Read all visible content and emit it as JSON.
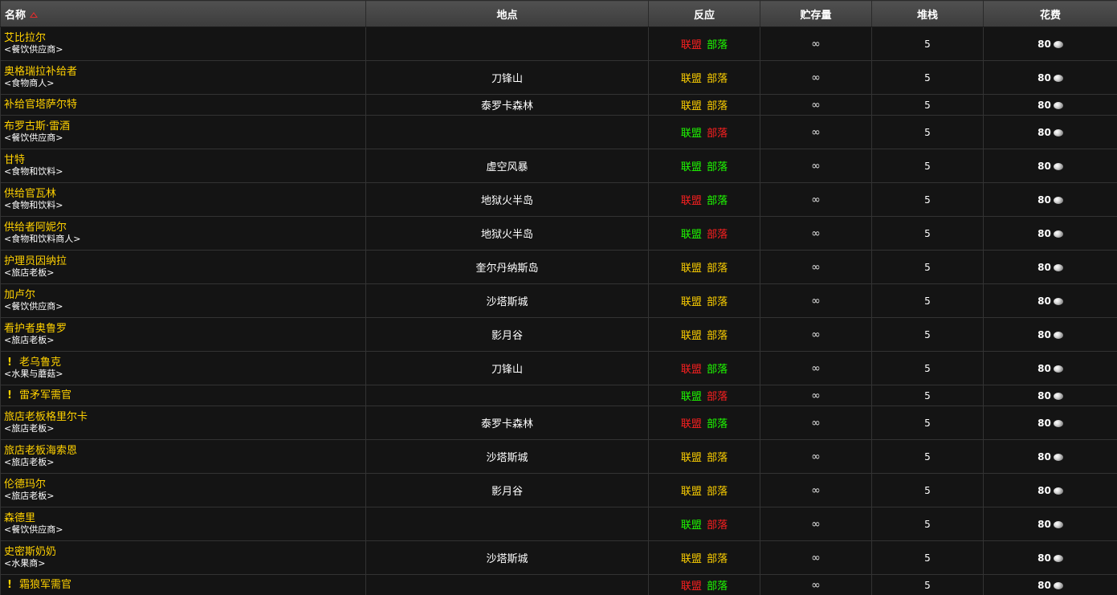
{
  "header": {
    "name": "名称",
    "location": "地点",
    "react": "反应",
    "stock": "贮存量",
    "stack": "堆栈",
    "cost": "花费"
  },
  "labels": {
    "alliance": "联盟",
    "horde": "部落",
    "infinite": "∞",
    "quest_mark": "!"
  },
  "colors": {
    "name": "#ffd100",
    "friendly": "#1eff00",
    "neutral": "#ffd100",
    "hostile": "#ff2020"
  },
  "rows": [
    {
      "name": "艾比拉尔",
      "tag": "<餐饮供应商>",
      "location": "",
      "alliance": "red",
      "horde": "green",
      "stack": "5",
      "cost": "80",
      "quest": false
    },
    {
      "name": "奥格瑞拉补给者",
      "tag": "<食物商人>",
      "location": "刀锋山",
      "alliance": "yellow",
      "horde": "yellow",
      "stack": "5",
      "cost": "80",
      "quest": false
    },
    {
      "name": "补给官塔萨尔特",
      "tag": "",
      "location": "泰罗卡森林",
      "alliance": "yellow",
      "horde": "yellow",
      "stack": "5",
      "cost": "80",
      "quest": false
    },
    {
      "name": "布罗古斯·雷酒",
      "tag": "<餐饮供应商>",
      "location": "",
      "alliance": "green",
      "horde": "red",
      "stack": "5",
      "cost": "80",
      "quest": false
    },
    {
      "name": "甘特",
      "tag": "<食物和饮料>",
      "location": "虚空风暴",
      "alliance": "green",
      "horde": "green",
      "stack": "5",
      "cost": "80",
      "quest": false
    },
    {
      "name": "供给官瓦林",
      "tag": "<食物和饮料>",
      "location": "地狱火半岛",
      "alliance": "red",
      "horde": "green",
      "stack": "5",
      "cost": "80",
      "quest": false
    },
    {
      "name": "供给者阿妮尔",
      "tag": "<食物和饮料商人>",
      "location": "地狱火半岛",
      "alliance": "green",
      "horde": "red",
      "stack": "5",
      "cost": "80",
      "quest": false
    },
    {
      "name": "护理员因纳拉",
      "tag": "<旅店老板>",
      "location": "奎尔丹纳斯岛",
      "alliance": "yellow",
      "horde": "yellow",
      "stack": "5",
      "cost": "80",
      "quest": false
    },
    {
      "name": "加卢尔",
      "tag": "<餐饮供应商>",
      "location": "沙塔斯城",
      "alliance": "yellow",
      "horde": "yellow",
      "stack": "5",
      "cost": "80",
      "quest": false
    },
    {
      "name": "看护者奥鲁罗",
      "tag": "<旅店老板>",
      "location": "影月谷",
      "alliance": "yellow",
      "horde": "yellow",
      "stack": "5",
      "cost": "80",
      "quest": false
    },
    {
      "name": "老乌鲁克",
      "tag": "<水果与蘑菇>",
      "location": "刀锋山",
      "alliance": "red",
      "horde": "green",
      "stack": "5",
      "cost": "80",
      "quest": true
    },
    {
      "name": "雷矛军需官",
      "tag": "",
      "location": "",
      "alliance": "green",
      "horde": "red",
      "stack": "5",
      "cost": "80",
      "quest": true
    },
    {
      "name": "旅店老板格里尔卡",
      "tag": "<旅店老板>",
      "location": "泰罗卡森林",
      "alliance": "red",
      "horde": "green",
      "stack": "5",
      "cost": "80",
      "quest": false
    },
    {
      "name": "旅店老板海索恩",
      "tag": "<旅店老板>",
      "location": "沙塔斯城",
      "alliance": "yellow",
      "horde": "yellow",
      "stack": "5",
      "cost": "80",
      "quest": false
    },
    {
      "name": "伦德玛尔",
      "tag": "<旅店老板>",
      "location": "影月谷",
      "alliance": "yellow",
      "horde": "yellow",
      "stack": "5",
      "cost": "80",
      "quest": false
    },
    {
      "name": "森德里",
      "tag": "<餐饮供应商>",
      "location": "",
      "alliance": "green",
      "horde": "red",
      "stack": "5",
      "cost": "80",
      "quest": false
    },
    {
      "name": "史密斯奶奶",
      "tag": "<水果商>",
      "location": "沙塔斯城",
      "alliance": "yellow",
      "horde": "yellow",
      "stack": "5",
      "cost": "80",
      "quest": false
    },
    {
      "name": "霜狼军需官",
      "tag": "",
      "location": "",
      "alliance": "red",
      "horde": "green",
      "stack": "5",
      "cost": "80",
      "quest": true
    }
  ]
}
